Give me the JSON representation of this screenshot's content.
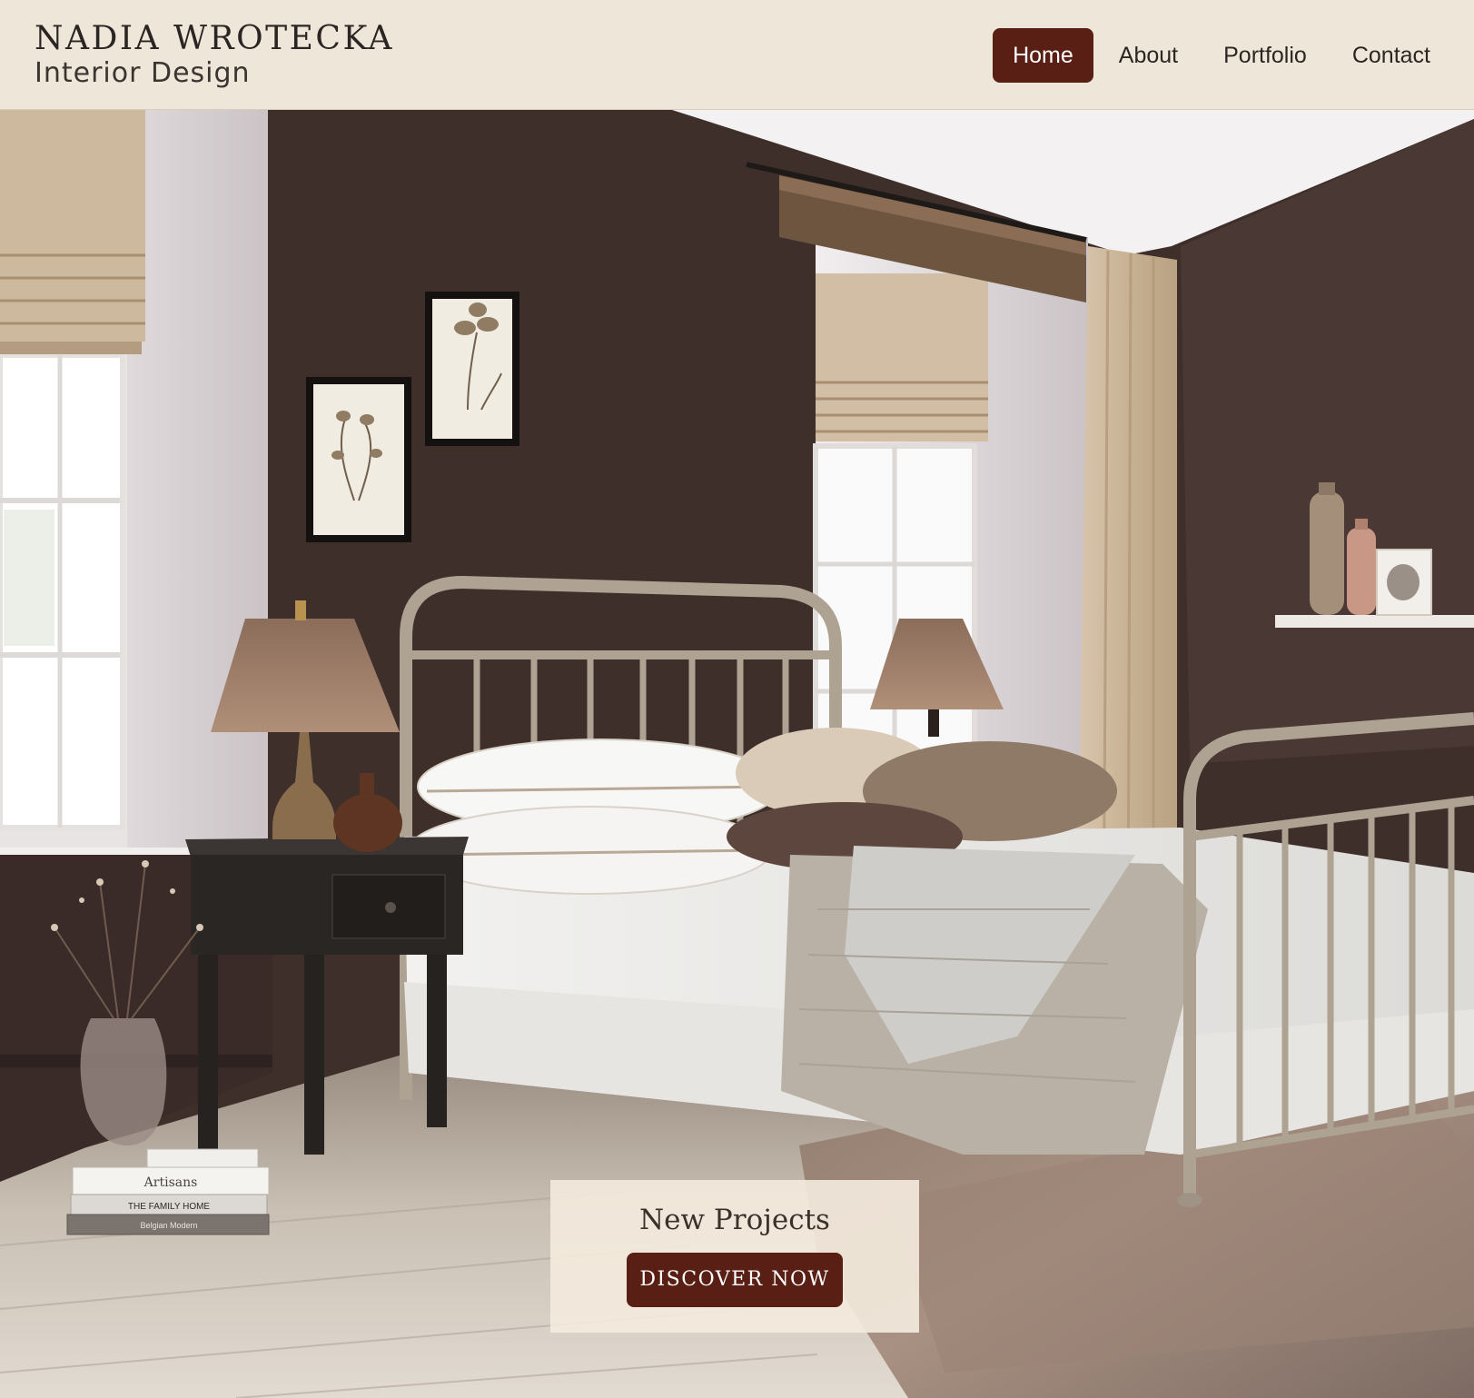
{
  "brand": {
    "name": "NADIA WROTECKA",
    "tagline": "Interior Design"
  },
  "nav": {
    "items": [
      {
        "label": "Home",
        "active": true
      },
      {
        "label": "About",
        "active": false
      },
      {
        "label": "Portfolio",
        "active": false
      },
      {
        "label": "Contact",
        "active": false
      }
    ]
  },
  "hero": {
    "image_subject": "bedroom interior with iron bed, nightstand, lamps and botanical prints",
    "book_titles": [
      "Artisans",
      "THE FAMILY HOME",
      "Belgian Modern"
    ]
  },
  "promo": {
    "title": "New Projects",
    "button_label": "DISCOVER NOW"
  },
  "colors": {
    "header_bg": "#efe6da",
    "accent": "#5a1f14",
    "wall": "#3e2f2b",
    "text_dark": "#2a2522"
  }
}
